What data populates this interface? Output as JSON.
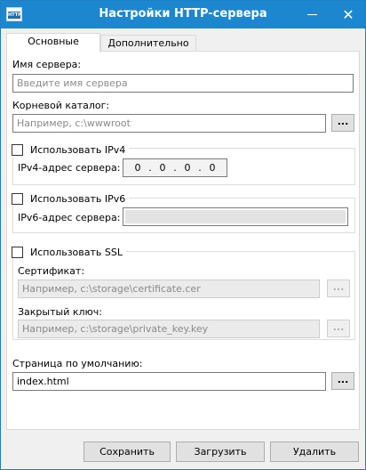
{
  "window": {
    "title": "Настройки HTTP-сервера",
    "icon_text": "HTTP",
    "minimize_icon": "minimize-icon",
    "close_icon": "close-icon",
    "close_glyph": "✕"
  },
  "tabs": [
    {
      "label": "Основные",
      "active": true
    },
    {
      "label": "Дополнительно",
      "active": false
    }
  ],
  "server_name": {
    "label": "Имя сервера:",
    "placeholder": "Введите имя сервера"
  },
  "root_dir": {
    "label": "Корневой каталог:",
    "placeholder": "Например, c:\\wwwroot",
    "browse_label": "..."
  },
  "ipv4": {
    "checkbox_label": "Использовать IPv4",
    "checked": false,
    "address_label": "IPv4-адрес сервера:",
    "octets": [
      "0",
      "0",
      "0",
      "0"
    ],
    "separator": "."
  },
  "ipv6": {
    "checkbox_label": "Использовать IPv6",
    "checked": false,
    "address_label": "IPv6-адрес сервера:"
  },
  "ssl": {
    "checkbox_label": "Использовать SSL",
    "checked": false,
    "certificate_label": "Сертификат:",
    "certificate_placeholder": "Например, c:\\storage\\certificate.cer",
    "private_key_label": "Закрытый ключ:",
    "private_key_placeholder": "Например, c:\\storage\\private_key.key",
    "browse_label": "..."
  },
  "default_page": {
    "label": "Страница по умолчанию:",
    "value": "index.html",
    "browse_label": "..."
  },
  "buttons": {
    "save": "Сохранить",
    "load": "Загрузить",
    "delete": "Удалить"
  },
  "colors": {
    "titlebar": "#1c87cf",
    "window_bg": "#f0f0f0",
    "panel_bg": "#ffffff"
  }
}
